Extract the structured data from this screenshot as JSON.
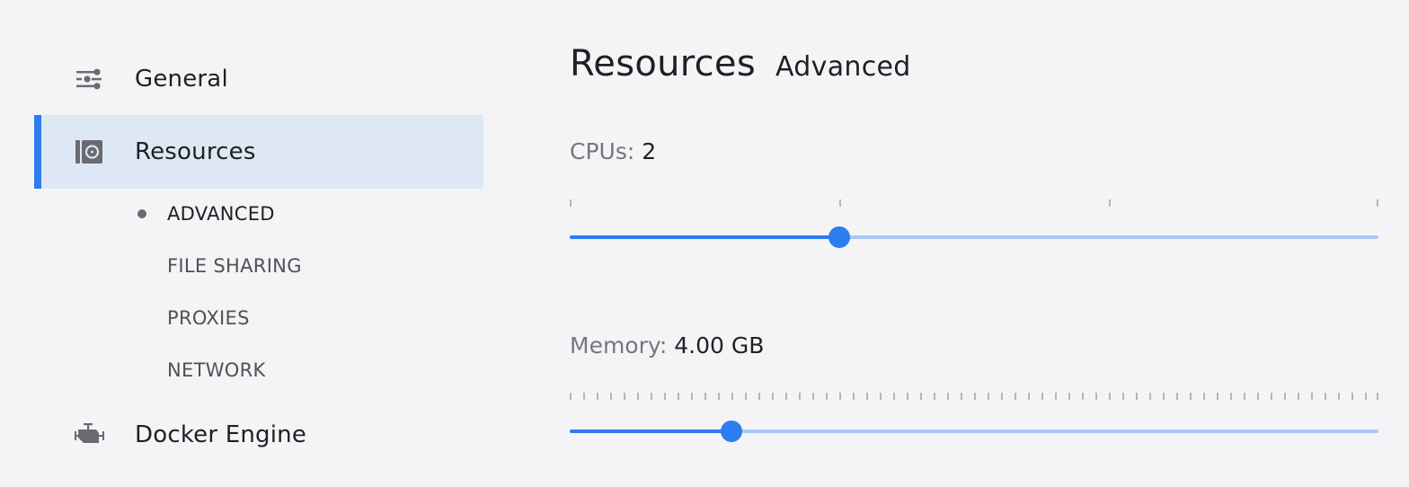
{
  "sidebar": {
    "items": [
      {
        "label": "General",
        "icon": "sliders-icon",
        "active": false
      },
      {
        "label": "Resources",
        "icon": "resources-disk-icon",
        "active": true
      },
      {
        "label": "Docker Engine",
        "icon": "engine-icon",
        "active": false
      }
    ],
    "sub_items": [
      {
        "label": "ADVANCED",
        "active": true
      },
      {
        "label": "FILE SHARING",
        "active": false
      },
      {
        "label": "PROXIES",
        "active": false
      },
      {
        "label": "NETWORK",
        "active": false
      }
    ]
  },
  "main": {
    "title": "Resources",
    "subtitle": "Advanced",
    "cpus": {
      "label": "CPUs:",
      "value": "2",
      "min": 1,
      "max": 4,
      "step": 1,
      "current": 2
    },
    "memory": {
      "label": "Memory:",
      "value": "4.00 GB",
      "min_gb": 1,
      "max_gb": 16,
      "step_gb": 0.25,
      "current_gb": 4
    }
  },
  "colors": {
    "accent": "#2d7cf0",
    "track_inactive": "#a9c8f3",
    "active_bg": "#dde8f4",
    "background": "#f4f4f7"
  }
}
